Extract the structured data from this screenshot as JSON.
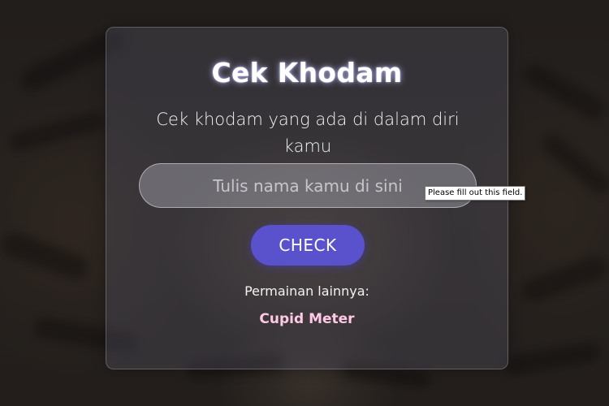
{
  "card": {
    "title": "Cek Khodam",
    "subtitle": "Cek khodam yang ada di dalam diri kamu"
  },
  "form": {
    "name_input": {
      "value": "",
      "placeholder": "Tulis nama kamu di sini"
    },
    "check_label": "CHECK",
    "validation_tooltip": "Please fill out this field."
  },
  "other_games": {
    "label": "Permainan lainnya:",
    "links": [
      {
        "label": "Cupid Meter"
      }
    ]
  },
  "colors": {
    "button": "#5a52cc",
    "link": "#ffc9e6",
    "title_glow": "#bebeff"
  }
}
